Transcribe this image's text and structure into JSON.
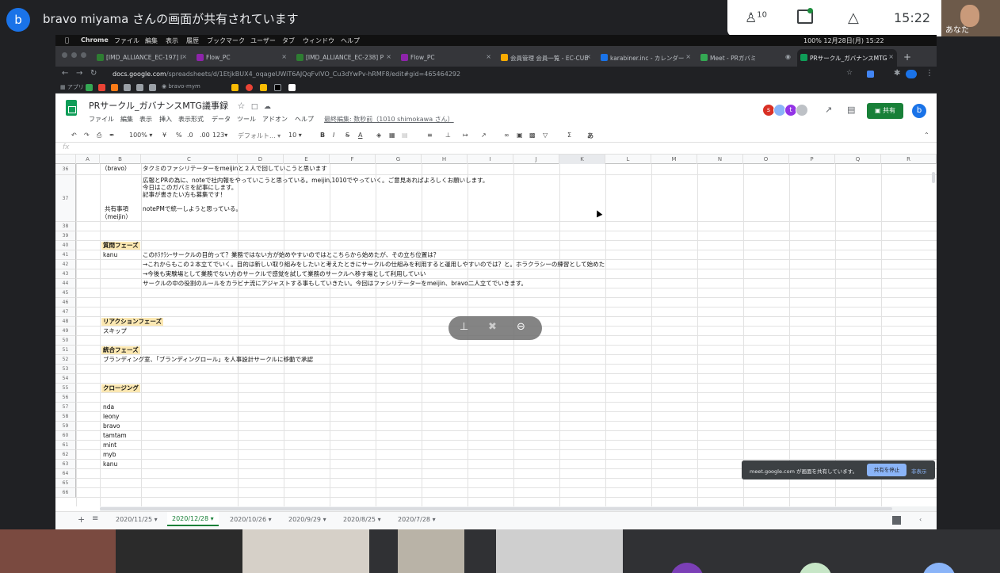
{
  "meet": {
    "presenter_initial": "b",
    "title": "bravo miyama さんの画面が共有されています",
    "participants_count": "10",
    "clock": "15:22",
    "self_label": "あなた"
  },
  "mac_menubar": {
    "app": "Chrome",
    "menus": [
      "ファイル",
      "編集",
      "表示",
      "履歴",
      "ブックマーク",
      "ユーザー",
      "タブ",
      "ウィンドウ",
      "ヘルプ"
    ],
    "status": "100% 12月28日(月) 15:22"
  },
  "browser": {
    "tabs": [
      {
        "label": "[IMD_ALLIANCE_EC-197] I",
        "color": "#2e7d32"
      },
      {
        "label": "Flow_PC",
        "color": "#8e24aa"
      },
      {
        "label": "[IMD_ALLIANCE_EC-238] P",
        "color": "#2e7d32"
      },
      {
        "label": "Flow_PC",
        "color": "#8e24aa"
      },
      {
        "label": "会員管理 会員一覧 - EC-CUB",
        "color": "#f9ab00"
      },
      {
        "label": "karabiner.inc - カレンダー",
        "color": "#1a73e8"
      },
      {
        "label": "Meet - PRガバミ",
        "color": "#34a853"
      },
      {
        "label": "PRサークル_ガバナンスMTG",
        "color": "#0f9d58"
      }
    ],
    "url_host": "docs.google.com",
    "url_path": "/spreadsheets/d/1EtjkBUX4_oqageUWiT6AJQqFvlVO_Cu3dYwPv-hRMF8/edit#gid=465464292",
    "bookmarks_label": "アプリ",
    "bookmark_user": "bravo-mym"
  },
  "sheet": {
    "title": "PRサークル_ガバナンスMTG議事録",
    "menus": [
      "ファイル",
      "編集",
      "表示",
      "挿入",
      "表示形式",
      "データ",
      "ツール",
      "アドオン",
      "ヘルプ"
    ],
    "last_edit": "最終編集: 数秒前（1010 shimokawa さん）",
    "share_label": "共有",
    "account_initial": "b",
    "collaborators": [
      {
        "initial": "s",
        "color": "#d93025"
      },
      {
        "initial": "",
        "color": "#8ab4f8"
      },
      {
        "initial": "t",
        "color": "#9334e6"
      },
      {
        "initial": "",
        "color": "#bdc1c6"
      }
    ],
    "toolbar": {
      "zoom": "100%",
      "currency": "¥",
      "percent": "%",
      "dec0": ".0",
      "dec00": ".00",
      "format123": "123",
      "font": "デフォルト...",
      "size": "10",
      "bold": "B",
      "italic": "I",
      "strike": "S",
      "textcolor": "A",
      "sigma": "Σ",
      "input_tool": "あ"
    },
    "fx": "fx",
    "columns": [
      "A",
      "B",
      "C",
      "D",
      "E",
      "F",
      "G",
      "H",
      "I",
      "J",
      "K",
      "L",
      "M",
      "N",
      "O",
      "P",
      "Q",
      "R"
    ],
    "rows": [
      {
        "n": "36",
        "b": "提案事項\n（bravo）",
        "c": "タクミのファシリテーターをmeijinと２人で回していこうと思います"
      },
      {
        "n": "37",
        "b": "共有事項\n（meijin）",
        "c": "広報とPRの為に、noteで社内報をやっていこうと思っている。meijin,1010でやっていく。ご意見あればよろしくお願いします。\n今日はこのガバミを記事にします。\n記事が書きたい方も募集です！\n\nnotePMで統一しようと思っている。"
      },
      {
        "n": "38",
        "b": "",
        "c": ""
      },
      {
        "n": "39",
        "b": "",
        "c": ""
      },
      {
        "n": "40",
        "b": "質問フェーズ",
        "c": ""
      },
      {
        "n": "41",
        "b": "kanu",
        "c": "このﾎﾗｸﾗｼｰサークルの目的って？業務ではない方が始めやすいのではとこちらから始めたが、その立ち位置は？"
      },
      {
        "n": "42",
        "b": "",
        "c": "→これからもこの２本立てでいく。目的は新しい取り組みをしたいと考えたときにサークルの仕組みを利用すると運用しやすいのでは？と。ホラクラシーの練習として始めた"
      },
      {
        "n": "43",
        "b": "",
        "c": "→今後も実験場として業務でない方のサークルで感覚を試して業務のサークルへ移す場として利用していい"
      },
      {
        "n": "44",
        "b": "",
        "c": "サークルの中の役割のルールをカラビナ流にアジャストする事もしていきたい。今回はファシリテーターをmeijin、bravo二人立てでいきます。"
      },
      {
        "n": "45",
        "b": "",
        "c": ""
      },
      {
        "n": "46",
        "b": "",
        "c": ""
      },
      {
        "n": "47",
        "b": "",
        "c": ""
      },
      {
        "n": "48",
        "b": "リアクションフェーズ",
        "c": ""
      },
      {
        "n": "49",
        "b": "スキップ",
        "c": ""
      },
      {
        "n": "50",
        "b": "",
        "c": ""
      },
      {
        "n": "51",
        "b": "統合フェーズ",
        "c": ""
      },
      {
        "n": "52",
        "b": "ブランディング室、「ブランディングロール」を人事設計サークルに移動で承認",
        "c": ""
      },
      {
        "n": "53",
        "b": "",
        "c": ""
      },
      {
        "n": "54",
        "b": "",
        "c": ""
      },
      {
        "n": "55",
        "b": "クロージング",
        "c": ""
      },
      {
        "n": "56",
        "b": "",
        "c": ""
      },
      {
        "n": "57",
        "b": "nda",
        "c": ""
      },
      {
        "n": "58",
        "b": "leony",
        "c": ""
      },
      {
        "n": "59",
        "b": "bravo",
        "c": ""
      },
      {
        "n": "60",
        "b": "tamtam",
        "c": ""
      },
      {
        "n": "61",
        "b": "mint",
        "c": ""
      },
      {
        "n": "62",
        "b": "myb",
        "c": ""
      },
      {
        "n": "63",
        "b": "kanu",
        "c": ""
      },
      {
        "n": "64",
        "b": "",
        "c": ""
      },
      {
        "n": "65",
        "b": "",
        "c": ""
      },
      {
        "n": "66",
        "b": "",
        "c": ""
      }
    ],
    "sheet_tabs": [
      "2020/11/25",
      "2020/12/28",
      "2020/10/26",
      "2020/9/29",
      "2020/8/25",
      "2020/7/28"
    ],
    "active_sheet_tab": "2020/12/28"
  },
  "share_notice": {
    "text": "meet.google.com が画面を共有しています。",
    "stop_label": "共有を停止",
    "hide_label": "非表示"
  }
}
